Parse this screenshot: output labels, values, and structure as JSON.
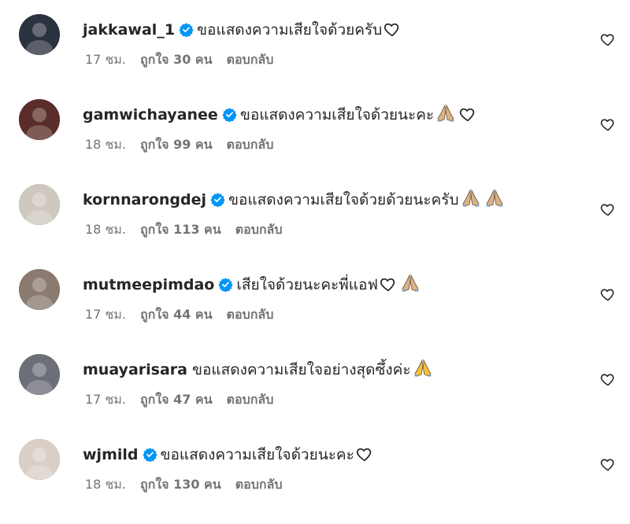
{
  "comments": [
    {
      "username": "jakkawal_1",
      "verified": true,
      "text": "ขอแสดงความเสียใจด้วยครับ",
      "emoji": [
        "heart"
      ],
      "time": "17 ชม.",
      "likes": "ถูกใจ 30 คน",
      "reply": "ตอบกลับ",
      "avatar_color": "#2c3340"
    },
    {
      "username": "gamwichayanee",
      "verified": true,
      "text": "ขอแสดงความเสียใจด้วยนะคะ",
      "emoji": [
        "pray",
        "heart"
      ],
      "time": "18 ชม.",
      "likes": "ถูกใจ 99 คน",
      "reply": "ตอบกลับ",
      "avatar_color": "#5a2d28"
    },
    {
      "username": "kornnarongdej",
      "verified": true,
      "text": "ขอแสดงความเสียใจด้วยด้วยนะครับ",
      "emoji": [
        "pray",
        "pray"
      ],
      "time": "18 ชม.",
      "likes": "ถูกใจ 113 คน",
      "reply": "ตอบกลับ",
      "avatar_color": "#cfc8bf"
    },
    {
      "username": "mutmeepimdao",
      "verified": true,
      "text": "เสียใจด้วยนะคะพี่แอฟ",
      "emoji": [
        "heart",
        "pray"
      ],
      "time": "17 ชม.",
      "likes": "ถูกใจ 44 คน",
      "reply": "ตอบกลับ",
      "avatar_color": "#8a7a70"
    },
    {
      "username": "muayarisara",
      "verified": false,
      "text": "ขอแสดงความเสียใจอย่างสุดซึ้งค่ะ",
      "emoji": [
        "pray-yellow"
      ],
      "time": "17 ชม.",
      "likes": "ถูกใจ 47 คน",
      "reply": "ตอบกลับ",
      "avatar_color": "#6d6f78"
    },
    {
      "username": "wjmild",
      "verified": true,
      "text": "ขอแสดงความเสียใจด้วยนะคะ",
      "emoji": [
        "heart"
      ],
      "time": "18 ชม.",
      "likes": "ถูกใจ 130 คน",
      "reply": "ตอบกลับ",
      "avatar_color": "#d9cfc7"
    }
  ],
  "colors": {
    "verified": "#0095f6",
    "text": "#262626",
    "meta": "#737373"
  },
  "icons": {
    "like_button": "heart-outline-icon",
    "verified_badge": "verified-badge-icon"
  }
}
